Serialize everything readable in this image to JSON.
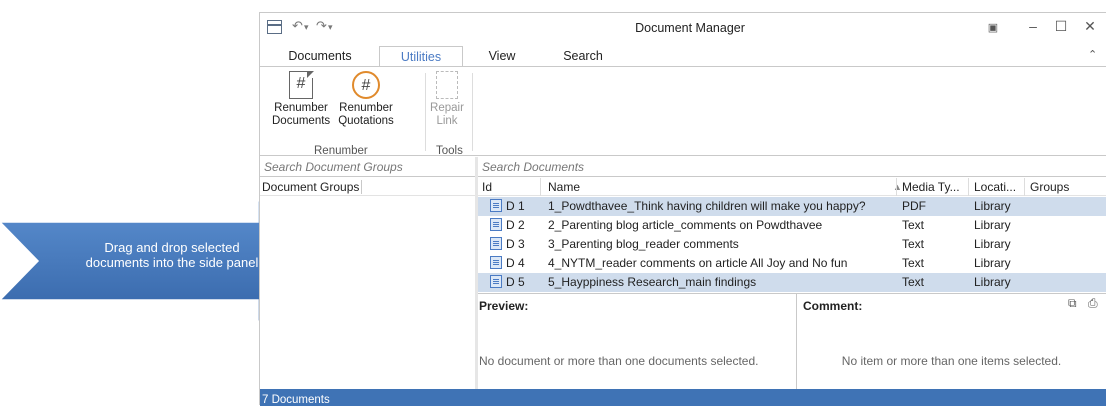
{
  "window": {
    "title": "Document Manager",
    "quick_access": [
      "↶",
      "▾",
      "↷",
      "▾"
    ],
    "controls": [
      "▣",
      "–",
      "☐",
      "✕"
    ],
    "collapse_ribbon": "⌃"
  },
  "tabs": [
    {
      "label": "Documents",
      "active": false
    },
    {
      "label": "Utilities",
      "active": true
    },
    {
      "label": "View",
      "active": false
    },
    {
      "label": "Search",
      "active": false
    }
  ],
  "ribbon": {
    "buttons": [
      {
        "label1": "Renumber",
        "label2": "Documents",
        "icon": "document-hash-icon"
      },
      {
        "label1": "Renumber",
        "label2": "Quotations",
        "icon": "circle-hash-icon"
      },
      {
        "label1": "Repair",
        "label2": "Link",
        "icon": "repair-link-icon"
      }
    ],
    "groups": [
      "Renumber",
      "Tools"
    ]
  },
  "groups_pane": {
    "search_placeholder": "Search Document Groups",
    "header": "Document Groups"
  },
  "documents_pane": {
    "search_placeholder": "Search Documents",
    "columns": [
      "Id",
      "Name",
      "Media Ty...",
      "Locati...",
      "Groups"
    ],
    "rows": [
      {
        "id": "D 1",
        "name": "1_Powdthavee_Think having children will make you happy?",
        "media": "PDF",
        "location": "Library",
        "groups": "",
        "selected": true
      },
      {
        "id": "D 2",
        "name": "2_Parenting blog article_comments on Powdthavee",
        "media": "Text",
        "location": "Library",
        "groups": "",
        "selected": false
      },
      {
        "id": "D 3",
        "name": "3_Parenting blog_reader comments",
        "media": "Text",
        "location": "Library",
        "groups": "",
        "selected": false
      },
      {
        "id": "D 4",
        "name": "4_NYTM_reader comments on article All Joy and No fun",
        "media": "Text",
        "location": "Library",
        "groups": "",
        "selected": false
      },
      {
        "id": "D 5",
        "name": "5_Hayppiness Research_main findings",
        "media": "Text",
        "location": "Library",
        "groups": "",
        "selected": true
      }
    ]
  },
  "preview": {
    "label": "Preview:",
    "message": "No document or more than one documents selected."
  },
  "comment": {
    "label": "Comment:",
    "message": "No item or more than one items selected."
  },
  "status": "7 Documents",
  "callout": {
    "text": "Drag and drop selected documents into the side panel",
    "color": "#3f73b5"
  }
}
